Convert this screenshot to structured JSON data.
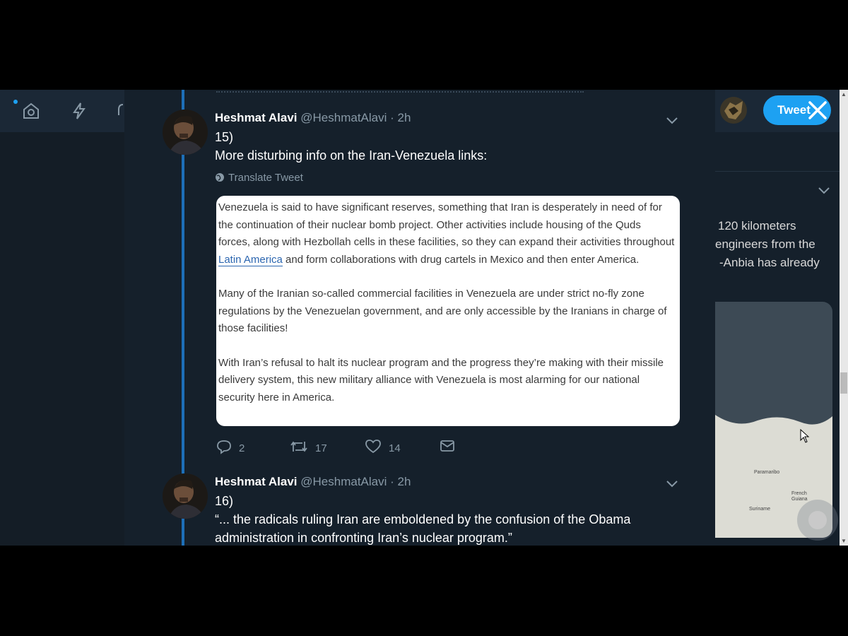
{
  "nav": {
    "tweet_button": "Tweet"
  },
  "tweets": [
    {
      "name": "Heshmat Alavi",
      "handle": "@HeshmatAlavi",
      "time": "· 2h",
      "number": "15)",
      "text": "More disturbing info on the Iran-Venezuela links:",
      "translate": "Translate Tweet",
      "quote": {
        "p1_before": "Venezuela is said to have significant reserves, something that Iran is desperately in need of for the continuation of their nuclear bomb project. Other activities include housing of the Quds forces, along with Hezbollah cells in these facilities, so they can expand their activities throughout ",
        "p1_link": "Latin America",
        "p1_after": " and form collaborations with drug cartels in Mexico and then enter America.",
        "p2": "Many of the Iranian so-called commercial facilities in Venezuela are under strict no-fly zone regulations by the Venezuelan government, and are only accessible by the Iranians in charge of those facilities!",
        "p3": "With Iran’s refusal to halt its nuclear program and the progress they’re making with their missile delivery system, this new military alliance with Venezuela is most alarming for our national security here in America."
      },
      "actions": {
        "replies": "2",
        "retweets": "17",
        "likes": "14"
      }
    },
    {
      "name": "Heshmat Alavi",
      "handle": "@HeshmatAlavi",
      "time": "· 2h",
      "number": "16)",
      "text_line1": "“... the radicals ruling Iran are emboldened by the confusion of the Obama",
      "text_line2": "administration in confronting Iran’s nuclear program.”"
    }
  ],
  "sidebar": {
    "lines": [
      "120 kilometers",
      "engineers from the",
      "-Anbia has already"
    ],
    "map_labels": [
      "Suriname",
      "French Guiana",
      "Paramaribo"
    ]
  },
  "colors": {
    "accent": "#1da1f2",
    "background": "#15202b",
    "muted": "#8899a6",
    "thread_line": "#1d6fb8"
  }
}
